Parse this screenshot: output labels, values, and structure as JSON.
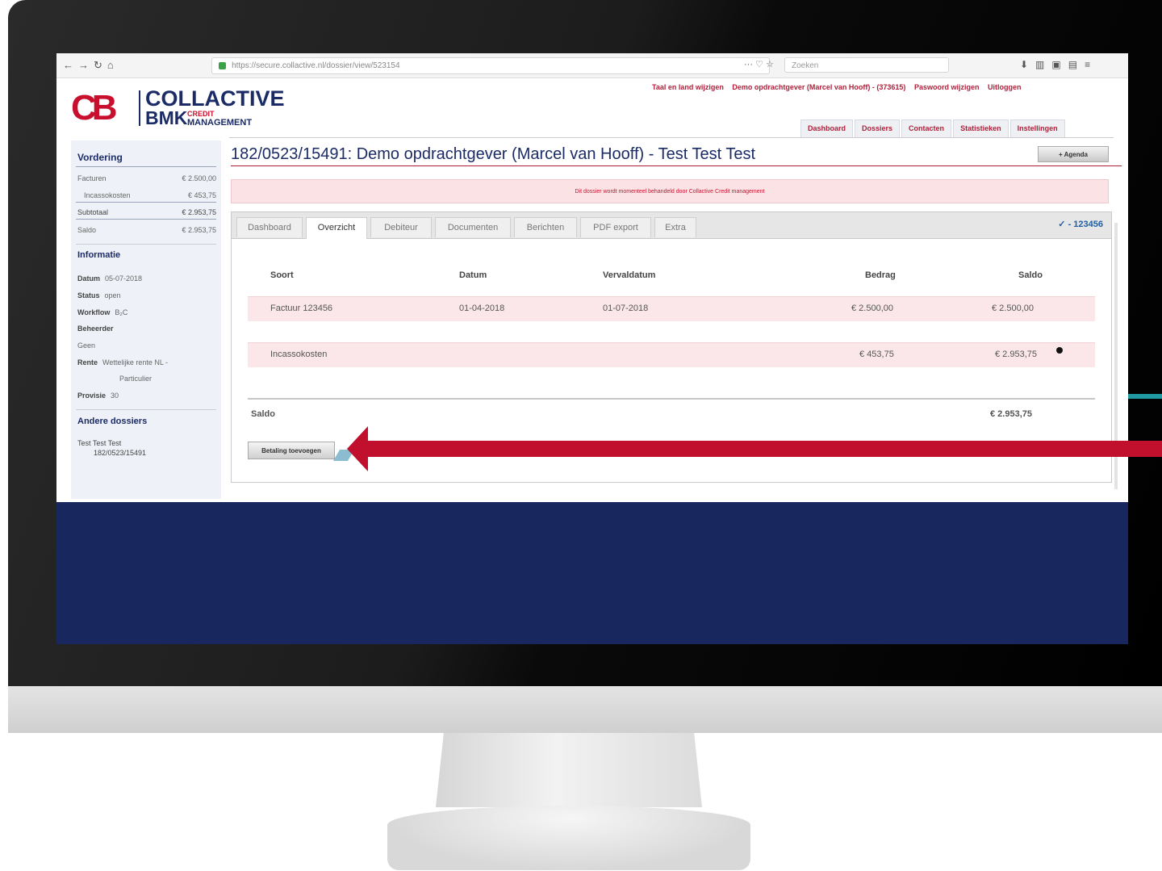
{
  "browser": {
    "url": "https://secure.collactive.nl/dossier/view/523154",
    "search_placeholder": "Zoeken"
  },
  "header": {
    "links": [
      "Taal en land wijzigen",
      "Demo opdrachtgever (Marcel van Hooff) - (373615)",
      "Paswoord wijzigen",
      "Uitloggen"
    ],
    "logo": {
      "mark": "CB",
      "line1": "COLLACTIVE",
      "line2": "BMK",
      "line3": "CREDIT",
      "line4": "MANAGEMENT"
    },
    "nav": [
      "Dashboard",
      "Dossiers",
      "Contacten",
      "Statistieken",
      "Instellingen"
    ]
  },
  "sidebar": {
    "vordering_title": "Vordering",
    "facturen_label": "Facturen",
    "facturen_value": "€ 2.500,00",
    "incasso_label": "Incassokosten",
    "incasso_value": "€ 453,75",
    "subtotaal_label": "Subtotaal",
    "subtotaal_value": "€ 2.953,75",
    "saldo_label": "Saldo",
    "saldo_value": "€ 2.953,75",
    "informatie_title": "Informatie",
    "datum_label": "Datum",
    "datum_value": "05-07-2018",
    "status_label": "Status",
    "status_value": "open",
    "workflow_label": "Workflow",
    "workflow_value": "B₂C",
    "beheerder_label": "Beheerder",
    "beheerder_value": "Geen",
    "rente_label": "Rente",
    "rente_value": "Wettelijke rente NL -",
    "rente_value2": "Particulier",
    "provisie_label": "Provisie",
    "provisie_value": "30",
    "andere_title": "Andere dossiers",
    "andere_name": "Test Test Test",
    "andere_id": "182/0523/15491"
  },
  "main": {
    "title": "182/0523/15491: Demo opdrachtgever (Marcel van Hooff) - Test Test Test",
    "agenda_button": "+ Agenda",
    "notice": "Dit dossier wordt momenteel behandeld door Collactive Credit management",
    "tabs": [
      "Dashboard",
      "Overzicht",
      "Debiteur",
      "Documenten",
      "Berichten",
      "PDF export",
      "Extra"
    ],
    "active_tab": "Overzicht",
    "tab_id": "✓ - 123456",
    "columns": [
      "Soort",
      "Datum",
      "Vervaldatum",
      "Bedrag",
      "Saldo"
    ],
    "rows": [
      {
        "soort": "Factuur 123456",
        "datum": "01-04-2018",
        "vervaldatum": "01-07-2018",
        "bedrag": "€ 2.500,00",
        "saldo": "€ 2.500,00"
      },
      {
        "soort": "Incassokosten",
        "datum": "",
        "vervaldatum": "",
        "bedrag": "€ 453,75",
        "saldo": "€ 2.953,75"
      }
    ],
    "saldo_label": "Saldo",
    "saldo_total": "€ 2.953,75",
    "pay_button": "Betaling toevoegen"
  },
  "colors": {
    "brand_red": "#c8102e",
    "brand_navy": "#1b2b66",
    "arrow": "#c0102e"
  }
}
